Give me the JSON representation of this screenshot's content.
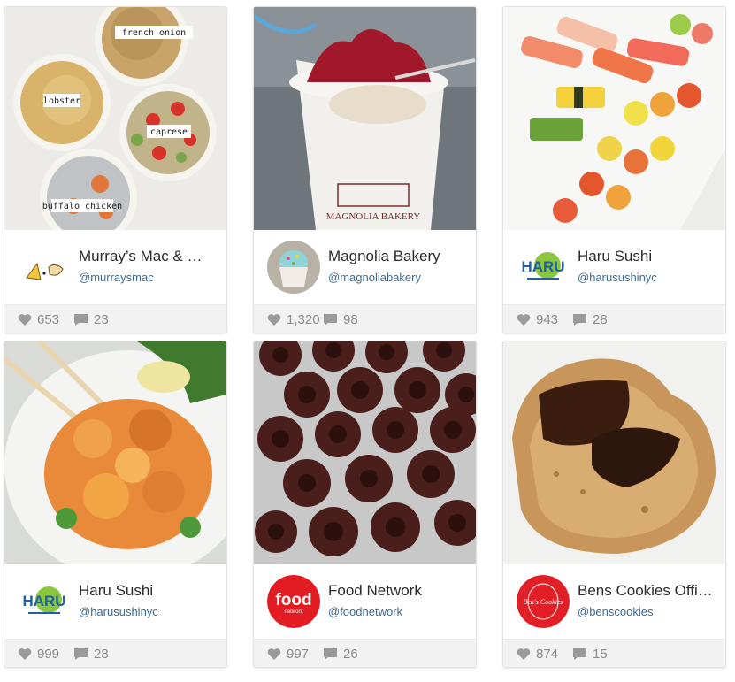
{
  "cards": [
    {
      "image_alt": "mac and cheese bowls",
      "image_labels": [
        "french onion",
        "lobster",
        "caprese",
        "buffalo chicken"
      ],
      "name": "Murray’s Mac & …",
      "handle": "@murraysmac",
      "likes": "653",
      "comments": "23"
    },
    {
      "image_alt": "red velvet cup",
      "cup_text": "MAGNOLIA BAKERY",
      "name": "Magnolia Bakery",
      "handle": "@magnoliabakery",
      "likes": "1,320",
      "comments": "98"
    },
    {
      "image_alt": "sushi platter",
      "logo_text": "HARU",
      "name": "Haru Sushi",
      "handle": "@harusushinyc",
      "likes": "943",
      "comments": "28"
    },
    {
      "image_alt": "fried shrimp bowl",
      "logo_text": "HARU",
      "name": "Haru Sushi",
      "handle": "@harusushinyc",
      "likes": "999",
      "comments": "28"
    },
    {
      "image_alt": "chocolate donuts",
      "logo_text": "food",
      "logo_subtext": "network",
      "name": "Food Network",
      "handle": "@foodnetwork",
      "likes": "997",
      "comments": "26"
    },
    {
      "image_alt": "chocolate cookie",
      "logo_text": "Ben's Cookies",
      "name": "Bens Cookies Offi…",
      "handle": "@benscookies",
      "likes": "874",
      "comments": "15"
    }
  ],
  "colors": {
    "handle": "#3b6b94",
    "stat_text": "#8a8a8a",
    "footer_bg": "#f2f2f2",
    "haru_blue": "#1d5fa8",
    "haru_green": "#8cc63f",
    "food_network_red": "#e31b23",
    "bens_red": "#e21f26"
  },
  "icons": {
    "like": "heart-icon",
    "comment": "comment-icon"
  }
}
